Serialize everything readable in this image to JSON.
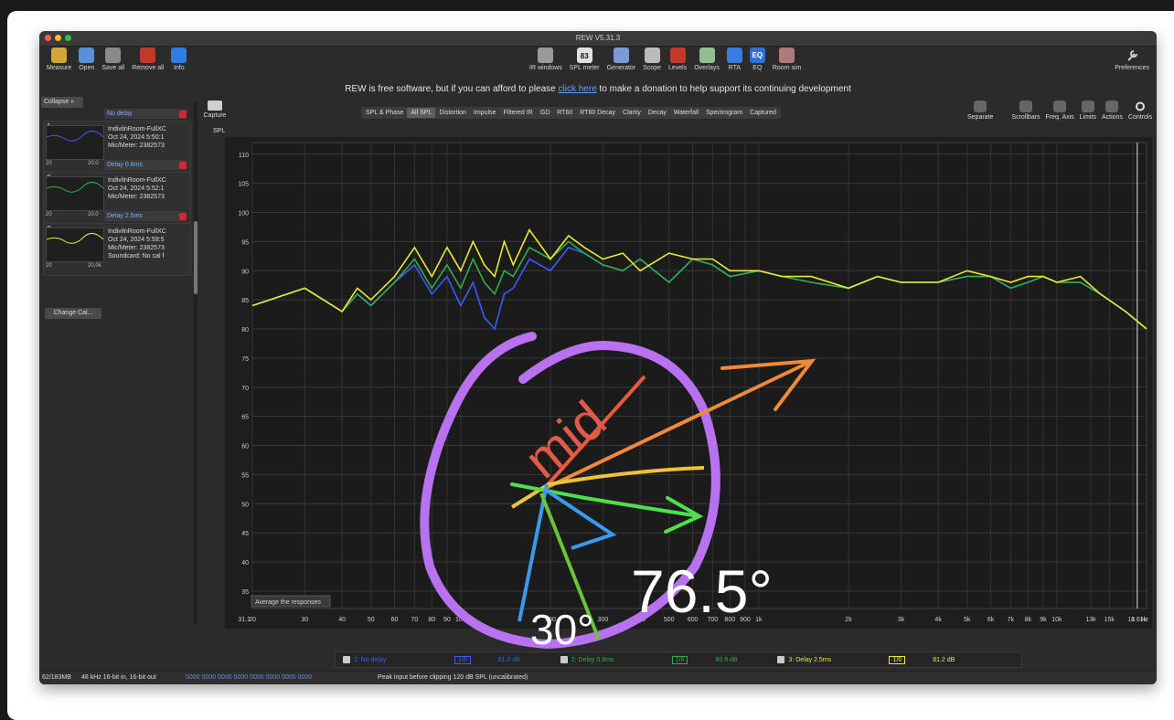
{
  "window": {
    "title": "REW V5.31.3"
  },
  "toolbar_left": [
    {
      "label": "Measure",
      "color": "#d4a63a"
    },
    {
      "label": "Open",
      "color": "#5b8fd6"
    },
    {
      "label": "Save all",
      "color": "#8a8a8a"
    },
    {
      "label": "Remove all",
      "color": "#c0392b"
    },
    {
      "label": "Info",
      "color": "#2f7de1"
    }
  ],
  "toolbar_center": [
    {
      "label": "IR windows",
      "color": "#9a9a9a"
    },
    {
      "label": "SPL meter",
      "color": "#e0e0e0"
    },
    {
      "label": "Generator",
      "color": "#7a9bd8"
    },
    {
      "label": "Scope",
      "color": "#bbbbbb"
    },
    {
      "label": "Levels",
      "color": "#c0392b"
    },
    {
      "label": "Overlays",
      "color": "#8fbf8f"
    },
    {
      "label": "RTA",
      "color": "#3a7de1"
    },
    {
      "label": "EQ",
      "color": "#2f6fd6"
    },
    {
      "label": "Room sim",
      "color": "#b07a7a"
    }
  ],
  "spl_meter_value": "83",
  "eq_label": "EQ",
  "preferences_label": "Preferences",
  "donation": {
    "before": "REW is free software, but if you can afford to please ",
    "link": "click here",
    "after": " to make a donation to help support its continuing development"
  },
  "collapse_label": "Collapse",
  "measurements": [
    {
      "num": "1",
      "title": "No delay",
      "name": "IndivilnRoom-FullXC",
      "date": "Oct 24, 2024 5:50:1",
      "mic": "Mic/Meter: 2382573",
      "extra": "",
      "mini_left": "20",
      "mini_right": "20,0",
      "color": "#3a5bff"
    },
    {
      "num": "2",
      "title": "Delay 0.8ms",
      "name": "IndivilnRoom-FullXC",
      "date": "Oct 24, 2024 5:52:1",
      "mic": "Mic/Meter: 2382573",
      "extra": "",
      "mini_left": "20",
      "mini_right": "20,0",
      "color": "#2fae4a"
    },
    {
      "num": "3",
      "title": "Delay 2.5ms",
      "name": "IndivilnRoom-FullXC",
      "date": "Oct 24, 2024 5:59:5",
      "mic": "Mic/Meter: 2382573",
      "extra": "Soundcard: No cal f",
      "mini_left": "20",
      "mini_right": "20,0k",
      "color": "#e8e83a"
    }
  ],
  "change_cal_label": "Change Cal...",
  "capture_label": "Capture",
  "spl_axis_label": "SPL",
  "tabs": [
    "SPL & Phase",
    "All SPL",
    "Distortion",
    "Impulse",
    "Filtered IR",
    "GD",
    "RT60",
    "RT60 Decay",
    "Clarity",
    "Decay",
    "Waterfall",
    "Spectrogram",
    "Captured"
  ],
  "selected_tab": "All SPL",
  "right_tools": [
    "Separate",
    "Scrollbars",
    "Freq. Axis",
    "Limits",
    "Actions",
    "Controls"
  ],
  "y_ticks": [
    "110",
    "105",
    "100",
    "95",
    "90",
    "85",
    "80",
    "75",
    "70",
    "65",
    "60",
    "55",
    "50",
    "45",
    "40",
    "35"
  ],
  "x_ticks": [
    "20",
    "30",
    "40",
    "50",
    "60",
    "70",
    "80",
    "90",
    "100",
    "200",
    "300",
    "400",
    "500",
    "600",
    "700",
    "800",
    "900",
    "1k",
    "2k",
    "3k",
    "4k",
    "5k",
    "6k",
    "7k",
    "8k",
    "9k",
    "10k",
    "13k",
    "15k",
    "1"
  ],
  "x_start_label": "31.1",
  "x_end_label": "18.61k",
  "x_unit": "Hz",
  "average_label": "Average the responses",
  "legend": [
    {
      "name": "1: No delay",
      "smoothing": "1/6",
      "level": "81.0 dB",
      "color": "#3a5bff"
    },
    {
      "name": "2: Delay 0.8ms",
      "smoothing": "1/6",
      "level": "80.8 dB",
      "color": "#2fae4a"
    },
    {
      "name": "3: Delay 2.5ms",
      "smoothing": "1/6",
      "level": "81.2 dB",
      "color": "#e8e83a"
    }
  ],
  "status": {
    "memory": "62/183MB",
    "format": "48 kHz  16-bit in, 16-bit out",
    "bits": "0000 0000  0000 0000  0000 0000  0000 0000",
    "peak": "Peak input before clipping 120 dB SPL (uncalibrated)"
  },
  "annotation": {
    "word": "mid",
    "angle_a": "30°",
    "angle_b": "76.5°"
  },
  "chart_data": {
    "type": "line",
    "title": "",
    "xlabel": "Hz",
    "ylabel": "SPL",
    "x_scale": "log",
    "xlim": [
      20,
      20000
    ],
    "ylim": [
      32,
      112
    ],
    "grid": true,
    "series": [
      {
        "name": "1: No delay",
        "color": "#3a5bff",
        "x": [
          20,
          30,
          40,
          45,
          50,
          60,
          70,
          80,
          90,
          100,
          110,
          120,
          130,
          140,
          150,
          170,
          200,
          230,
          260,
          300,
          350,
          400,
          500,
          600,
          700,
          800,
          1000,
          1200,
          1500,
          2000,
          2500,
          3000,
          4000,
          5000,
          6000,
          7000,
          8000,
          9000,
          10000,
          12000,
          14000,
          17000,
          20000
        ],
        "y": [
          84,
          87,
          83,
          86,
          84,
          88,
          91,
          86,
          89,
          84,
          88,
          82,
          80,
          86,
          87,
          92,
          90,
          94,
          93,
          91,
          90,
          92,
          88,
          92,
          91,
          89,
          90,
          89,
          88,
          87,
          89,
          88,
          88,
          89,
          89,
          87,
          88,
          89,
          88,
          88,
          86,
          83,
          80
        ]
      },
      {
        "name": "2: Delay 0.8ms",
        "color": "#2fae4a",
        "x": [
          20,
          30,
          40,
          45,
          50,
          60,
          70,
          80,
          90,
          100,
          110,
          120,
          130,
          140,
          150,
          170,
          200,
          230,
          260,
          300,
          350,
          400,
          500,
          600,
          700,
          800,
          1000,
          1200,
          1500,
          2000,
          2500,
          3000,
          4000,
          5000,
          6000,
          7000,
          8000,
          9000,
          10000,
          12000,
          14000,
          17000,
          20000
        ],
        "y": [
          84,
          87,
          83,
          86,
          84,
          88,
          92,
          87,
          91,
          87,
          92,
          88,
          86,
          90,
          89,
          94,
          92,
          95,
          93,
          91,
          90,
          92,
          88,
          92,
          91,
          89,
          90,
          89,
          88,
          87,
          89,
          88,
          88,
          89,
          89,
          87,
          88,
          89,
          88,
          88,
          86,
          83,
          80
        ]
      },
      {
        "name": "3: Delay 2.5ms",
        "color": "#e8e83a",
        "x": [
          20,
          30,
          40,
          45,
          50,
          60,
          70,
          80,
          90,
          100,
          110,
          120,
          130,
          140,
          150,
          170,
          200,
          230,
          260,
          300,
          350,
          400,
          500,
          600,
          700,
          800,
          1000,
          1200,
          1500,
          2000,
          2500,
          3000,
          4000,
          5000,
          6000,
          7000,
          8000,
          9000,
          10000,
          12000,
          14000,
          17000,
          20000
        ],
        "y": [
          84,
          87,
          83,
          87,
          85,
          89,
          94,
          89,
          94,
          90,
          95,
          91,
          89,
          95,
          91,
          97,
          92,
          96,
          94,
          92,
          93,
          90,
          93,
          92,
          92,
          90,
          90,
          89,
          89,
          87,
          89,
          88,
          88,
          90,
          89,
          88,
          89,
          89,
          88,
          89,
          86,
          83,
          80
        ]
      }
    ]
  }
}
